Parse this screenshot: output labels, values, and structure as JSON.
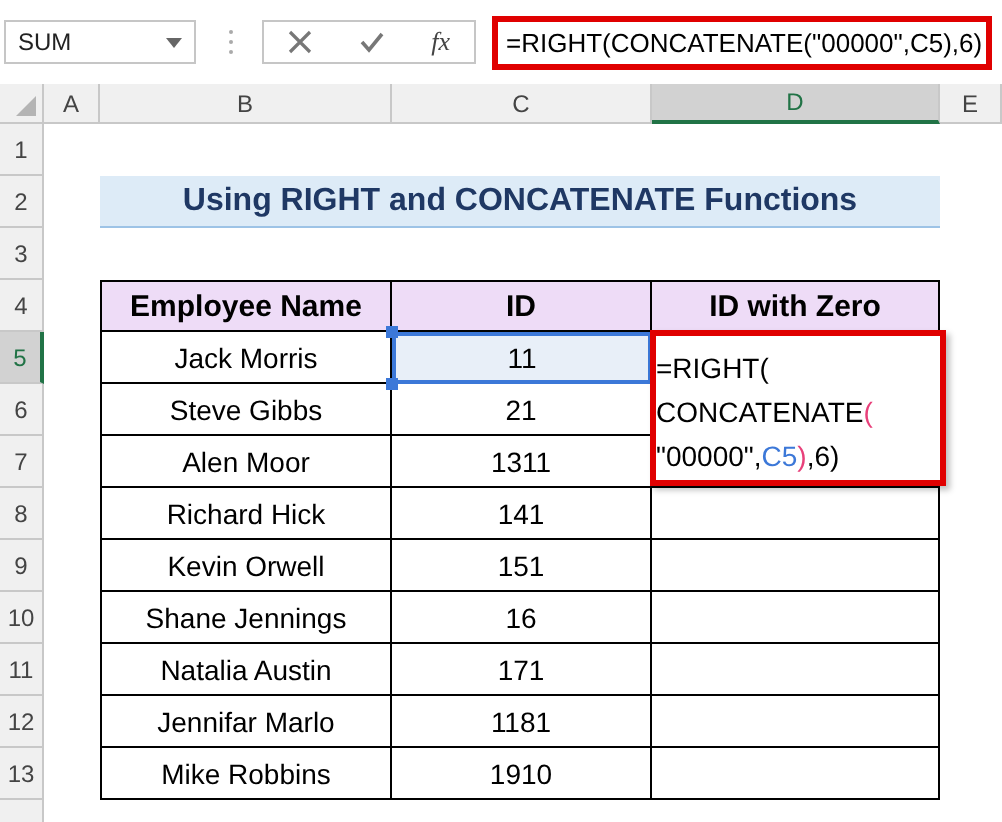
{
  "name_box": "SUM",
  "fx_label": "fx",
  "formula": "=RIGHT(CONCATENATE(\"00000\",C5),6)",
  "columns": [
    {
      "label": "A",
      "selected": false
    },
    {
      "label": "B",
      "selected": false
    },
    {
      "label": "C",
      "selected": false
    },
    {
      "label": "D",
      "selected": true
    },
    {
      "label": "E",
      "selected": false
    }
  ],
  "rows": [
    {
      "label": "1",
      "selected": false
    },
    {
      "label": "2",
      "selected": false
    },
    {
      "label": "3",
      "selected": false
    },
    {
      "label": "4",
      "selected": false
    },
    {
      "label": "5",
      "selected": true
    },
    {
      "label": "6",
      "selected": false
    },
    {
      "label": "7",
      "selected": false
    },
    {
      "label": "8",
      "selected": false
    },
    {
      "label": "9",
      "selected": false
    },
    {
      "label": "10",
      "selected": false
    },
    {
      "label": "11",
      "selected": false
    },
    {
      "label": "12",
      "selected": false
    },
    {
      "label": "13",
      "selected": false
    }
  ],
  "title": "Using RIGHT and CONCATENATE Functions",
  "table": {
    "columns": [
      "Employee Name",
      "ID",
      "ID with Zero"
    ],
    "rows": [
      {
        "name": "Jack Morris",
        "id": "11",
        "selected": true
      },
      {
        "name": "Steve Gibbs",
        "id": "21",
        "selected": false
      },
      {
        "name": "Alen Moor",
        "id": "1311",
        "selected": false
      },
      {
        "name": "Richard Hick",
        "id": "141",
        "selected": false
      },
      {
        "name": "Kevin Orwell",
        "id": "151",
        "selected": false
      },
      {
        "name": "Shane Jennings",
        "id": "16",
        "selected": false
      },
      {
        "name": "Natalia Austin",
        "id": "171",
        "selected": false
      },
      {
        "name": "Jennifar Marlo",
        "id": "1181",
        "selected": false
      },
      {
        "name": "Mike Robbins",
        "id": "1910",
        "selected": false
      }
    ]
  },
  "cell_editor": {
    "lines": [
      [
        {
          "text": "=RIGHT(",
          "color": "#000000"
        }
      ],
      [
        {
          "text": "CONCATENATE",
          "color": "#000000"
        },
        {
          "text": "(",
          "color": "#e8407a"
        }
      ],
      [
        {
          "text": "\"00000\",",
          "color": "#000000"
        },
        {
          "text": "C5",
          "color": "#3c78d8"
        },
        {
          "text": ")",
          "color": "#e8407a"
        },
        {
          "text": ",6)",
          "color": "#000000"
        }
      ]
    ]
  }
}
